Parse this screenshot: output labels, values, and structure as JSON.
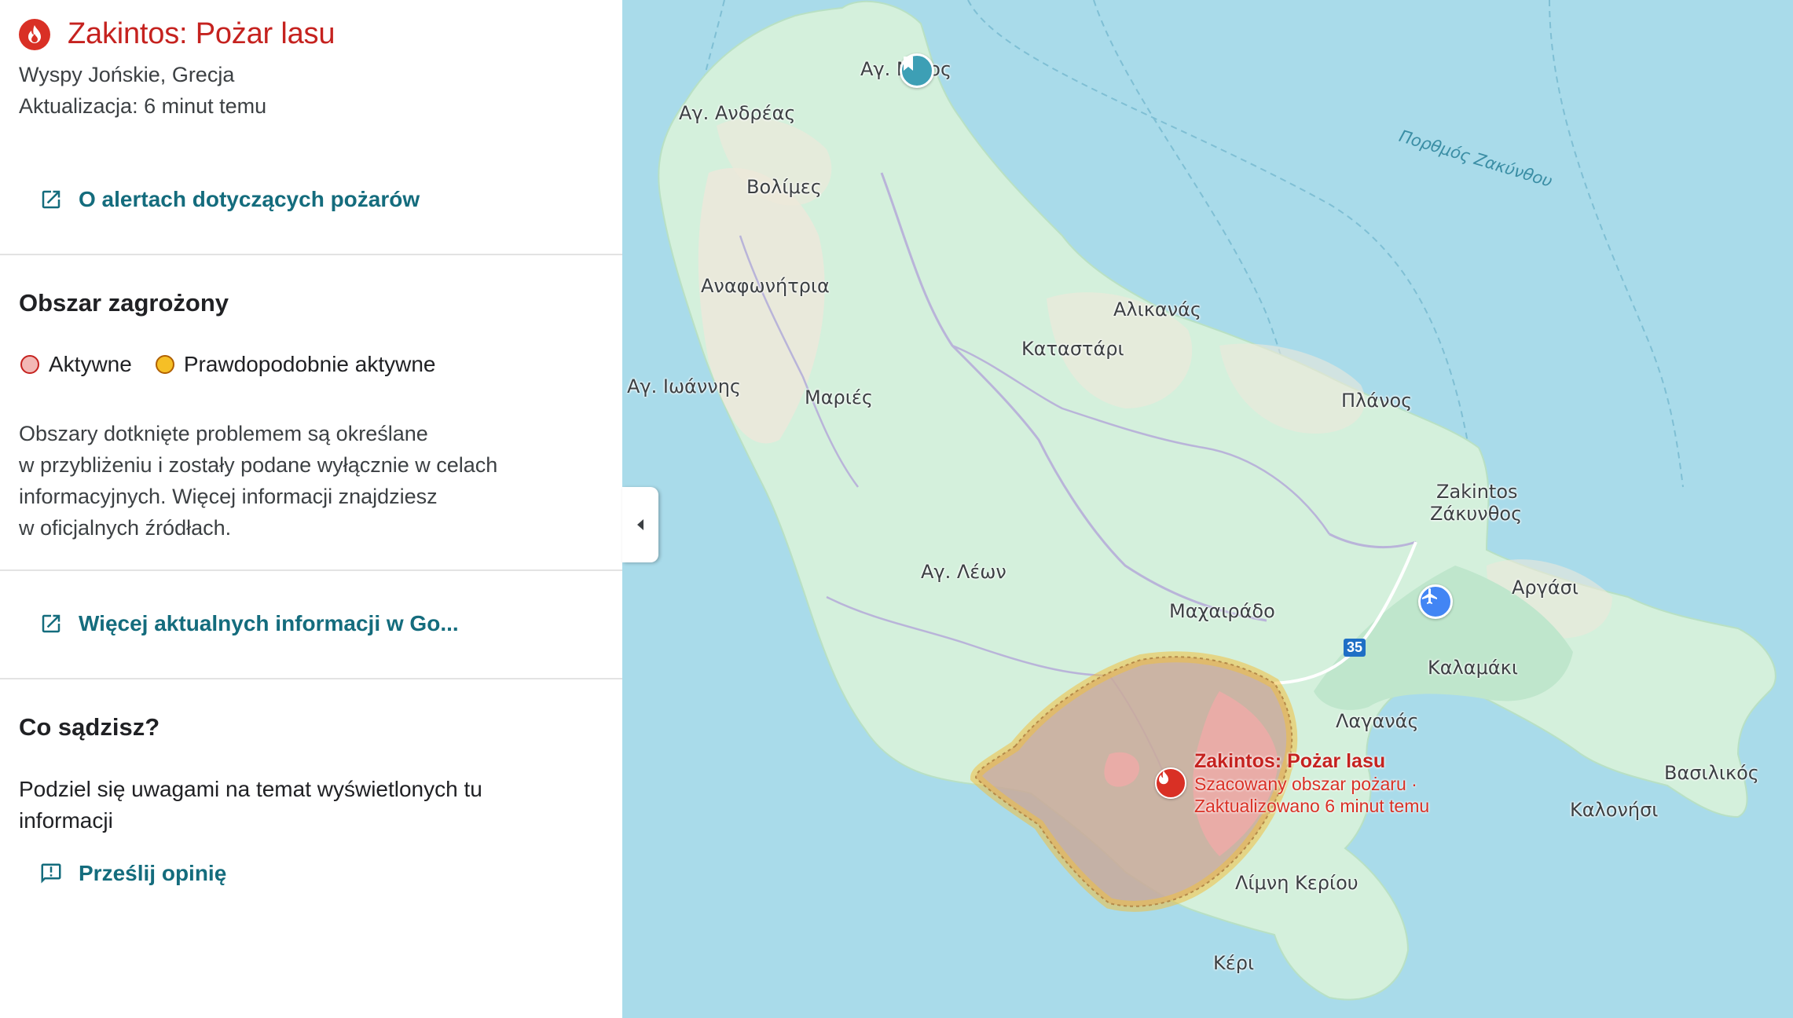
{
  "panel": {
    "title": "Zakintos: Pożar lasu",
    "location": "Wyspy Jońskie, Grecja",
    "updated": "Aktualizacja: 6 minut temu",
    "about_link": "O alertach dotyczących pożarów",
    "area_heading": "Obszar zagrożony",
    "legend": {
      "active": "Aktywne",
      "likely_active": "Prawdopodobnie aktywne"
    },
    "disclaimer_lines": [
      "Obszary dotknięte problemem są określane",
      "w przybliżeniu i zostały podane wyłącznie w celach",
      "informacyjnych. Więcej informacji znajdziesz",
      "w oficjalnych źródłach."
    ],
    "more_info_link": "Więcej aktualnych informacji w Go...",
    "feedback_heading": "Co sądzisz?",
    "feedback_lines": [
      "Podziel się uwagami na temat wyświetlonych tu",
      "informacji"
    ],
    "feedback_link": "Prześlij opinię"
  },
  "map": {
    "places": {
      "ag_nikolaos": "Αγ. Ν      αος",
      "ag_andreas": "Αγ. Ανδρέας",
      "volimes": "Βολίμες",
      "anafonitria": "Αναφωνήτρια",
      "alikanas": "Αλικανάς",
      "katastari": "Καταστάρι",
      "ag_ioannis": "Αγ. Ιωάννης",
      "maries": "Μαριές",
      "planos": "Πλάνος",
      "zakintos_latin": "Zakintos",
      "zakynthos": "Ζάκυνθος",
      "ag_leon": "Αγ. Λέων",
      "machairado": "Μαχαιράδο",
      "argasi": "Αργάσι",
      "kalamaki": "Καλαμάκι",
      "laganas": "Λαγανάς",
      "vasilikos": "Βασιλικός",
      "kalonisi": "Καλονήσι",
      "limni_keriou": "Λίμνη Κερίου",
      "keri": "Κέρι"
    },
    "sea_label": "Πορθμός Ζακύνθου",
    "road_number": "35",
    "fire_label": {
      "title": "Zakintos: Pożar lasu",
      "line1": "Szacowany obszar pożaru ·",
      "line2": "Zaktualizowano 6 minut temu"
    },
    "colors": {
      "water": "#a9dbea",
      "land": "#d4f0dc",
      "fire_fill": "#c9a99a",
      "fire_stroke": "#f0c040",
      "accent_link": "#146c7d",
      "alert_red": "#c5221f"
    }
  }
}
